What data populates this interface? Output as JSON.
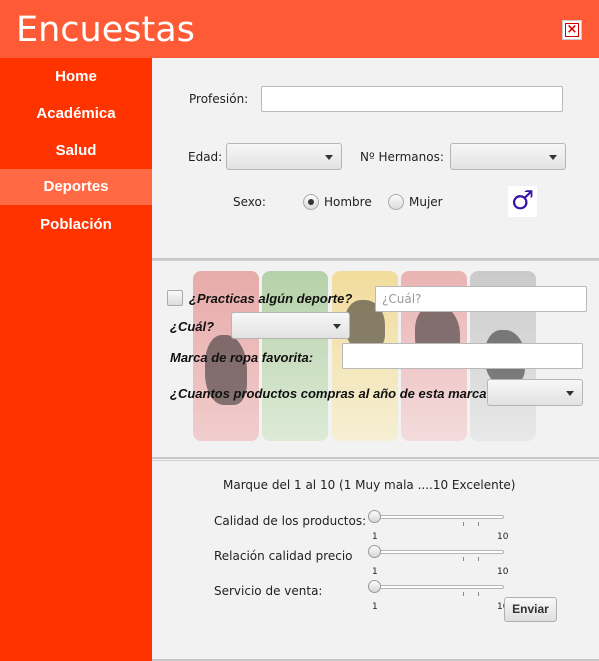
{
  "window": {
    "title": "Encuestas",
    "close_icon": "close-icon"
  },
  "sidebar": {
    "items": [
      {
        "label": "Home"
      },
      {
        "label": "Académica"
      },
      {
        "label": "Salud"
      },
      {
        "label": "Deportes",
        "active": true
      },
      {
        "label": "Población"
      }
    ]
  },
  "personal": {
    "profession_label": "Profesión:",
    "profession_value": "",
    "age_label": "Edad:",
    "siblings_label": "Nº Hermanos:",
    "sex_label": "Sexo:",
    "sex_options": [
      "Hombre",
      "Mujer"
    ],
    "sex_selected": "Hombre",
    "sex_symbol": "♂"
  },
  "sports": {
    "practice_question": "¿Practicas algún deporte?",
    "which_placeholder": "¿Cuál?",
    "which_label": "¿Cuál?",
    "brand_label": "Marca de ropa favorita:",
    "purchases_label": "¿Cuantos productos compras al año de esta marca?"
  },
  "rating": {
    "instructions": "Marque del 1 al 10 (1 Muy mala ....10 Excelente)",
    "sliders": [
      {
        "label": "Calidad de los productos:",
        "min": "1",
        "max": "10",
        "value": 1
      },
      {
        "label": "Relación calidad precio",
        "min": "1",
        "max": "10",
        "value": 1
      },
      {
        "label": "Servicio de venta:",
        "min": "1",
        "max": "10",
        "value": 1
      }
    ],
    "submit_label": "Enviar"
  },
  "colors": {
    "header": "#ff5a36",
    "sidebar": "#ff3300",
    "sidebar_active": "#ff6a45"
  }
}
